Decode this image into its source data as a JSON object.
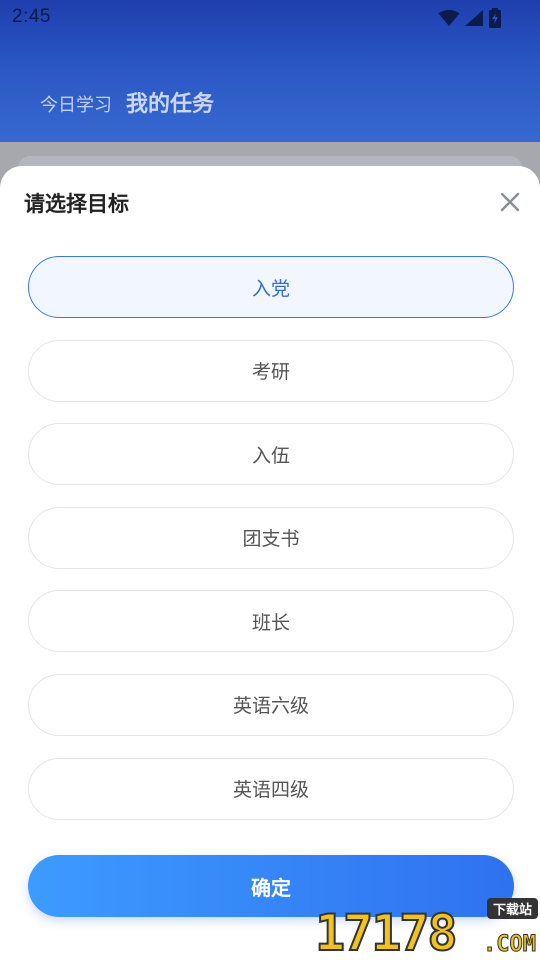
{
  "status_bar": {
    "time": "2:45",
    "icons": [
      "wifi-icon",
      "signal-icon",
      "battery-icon"
    ]
  },
  "header": {
    "tabs": [
      {
        "label": "今日学习",
        "active": false
      },
      {
        "label": "我的任务",
        "active": true
      }
    ]
  },
  "sheet": {
    "title": "请选择目标",
    "close_icon": "close-icon",
    "options": [
      {
        "label": "入党",
        "selected": true
      },
      {
        "label": "考研",
        "selected": false
      },
      {
        "label": "入伍",
        "selected": false
      },
      {
        "label": "团支书",
        "selected": false
      },
      {
        "label": "班长",
        "selected": false
      },
      {
        "label": "英语六级",
        "selected": false
      },
      {
        "label": "英语四级",
        "selected": false
      }
    ],
    "confirm_label": "确定"
  },
  "watermark": {
    "digits": "17178",
    "tag": "下载站",
    "domain": ".COM"
  },
  "colors": {
    "header_top": "#1f3fae",
    "accent": "#2f6fd8",
    "confirm_start": "#3d9bff",
    "confirm_end": "#2f71f0"
  }
}
